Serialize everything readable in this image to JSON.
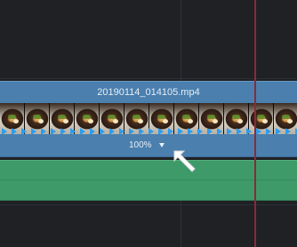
{
  "timeline": {
    "video_clip": {
      "filename": "20190114_014105.mp4",
      "speed_label": "100%"
    }
  },
  "colors": {
    "background": "#1f2125",
    "video_clip": "#4a7fae",
    "audio_clip": "#3f9a6a",
    "playhead": "#8a2a3a",
    "marker": "#2b9df0"
  },
  "icons": {
    "speed_dropdown": "chevron-down-icon",
    "pointer": "arrow-pointer-icon"
  }
}
